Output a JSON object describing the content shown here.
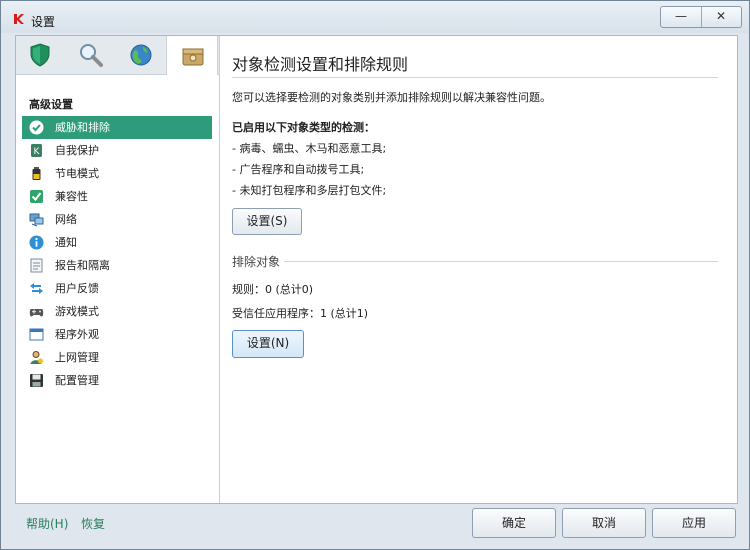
{
  "window": {
    "title": "设置",
    "min_label": "—",
    "close_label": "✕"
  },
  "sidebar": {
    "tabs": [
      {
        "icon": "shield-icon"
      },
      {
        "icon": "magnifier-icon"
      },
      {
        "icon": "globe-icon"
      },
      {
        "icon": "toolbox-icon",
        "active": true
      }
    ],
    "heading": "高级设置",
    "items": [
      {
        "label": "威胁和排除",
        "icon": "check-shield-icon",
        "active": true
      },
      {
        "label": "自我保护",
        "icon": "self-defense-icon"
      },
      {
        "label": "节电模式",
        "icon": "battery-icon"
      },
      {
        "label": "兼容性",
        "icon": "checkbox-icon"
      },
      {
        "label": "网络",
        "icon": "network-icon"
      },
      {
        "label": "通知",
        "icon": "info-icon"
      },
      {
        "label": "报告和隔离",
        "icon": "report-icon"
      },
      {
        "label": "用户反馈",
        "icon": "arrows-icon"
      },
      {
        "label": "游戏模式",
        "icon": "gamepad-icon"
      },
      {
        "label": "程序外观",
        "icon": "window-icon"
      },
      {
        "label": "上网管理",
        "icon": "user-icon"
      },
      {
        "label": "配置管理",
        "icon": "floppy-icon"
      }
    ]
  },
  "main": {
    "title": "对象检测设置和排除规则",
    "description": "您可以选择要检测的对象类别并添加排除规则以解决兼容性问题。",
    "enabled_heading": "已启用以下对象类型的检测：",
    "types": [
      "- 病毒、蠕虫、木马和恶意工具;",
      "- 广告程序和自动拨号工具;",
      "- 未知打包程序和多层打包文件;"
    ],
    "settings_s_label": "设置(S)",
    "exclusions_heading": "排除对象",
    "rules": "规则：0 (总计0)",
    "trusted": "受信任应用程序：1 (总计1)",
    "settings_n_label": "设置(N)"
  },
  "footer": {
    "help_label": "帮助(H)",
    "restore_label": "恢复",
    "ok_label": "确定",
    "cancel_label": "取消",
    "apply_label": "应用"
  },
  "colors": {
    "accent": "#2e9c7a",
    "link": "#2a7f5e"
  }
}
